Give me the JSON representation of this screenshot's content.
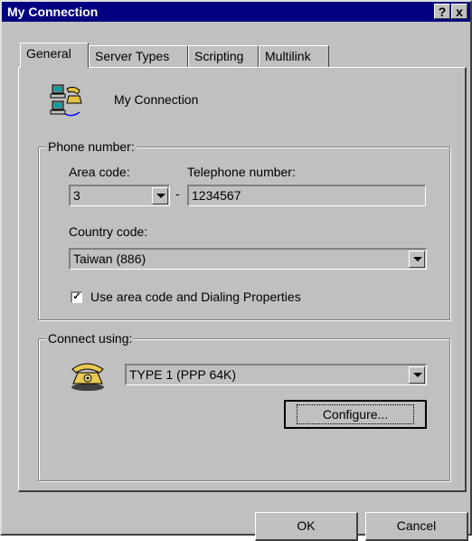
{
  "window": {
    "title": "My Connection",
    "help_button": "?",
    "close_button": "x"
  },
  "tabs": [
    {
      "label": "General"
    },
    {
      "label": "Server Types"
    },
    {
      "label": "Scripting"
    },
    {
      "label": "Multilink"
    }
  ],
  "connection": {
    "name": "My Connection",
    "icon": "dialup-computers-icon"
  },
  "phone": {
    "group_label": "Phone number:",
    "area_code_label": "Area code:",
    "area_code_value": "3",
    "dash": "-",
    "telephone_label": "Telephone number:",
    "telephone_value": "1234567",
    "country_label": "Country code:",
    "country_value": "Taiwan (886)",
    "use_area_code_label": "Use area code and Dialing Properties",
    "use_area_code_checked": true
  },
  "connect": {
    "group_label": "Connect using:",
    "device_value": "TYPE 1 (PPP 64K)",
    "device_icon": "telephone-icon",
    "configure_label": "Configure..."
  },
  "footer": {
    "ok_label": "OK",
    "cancel_label": "Cancel"
  }
}
